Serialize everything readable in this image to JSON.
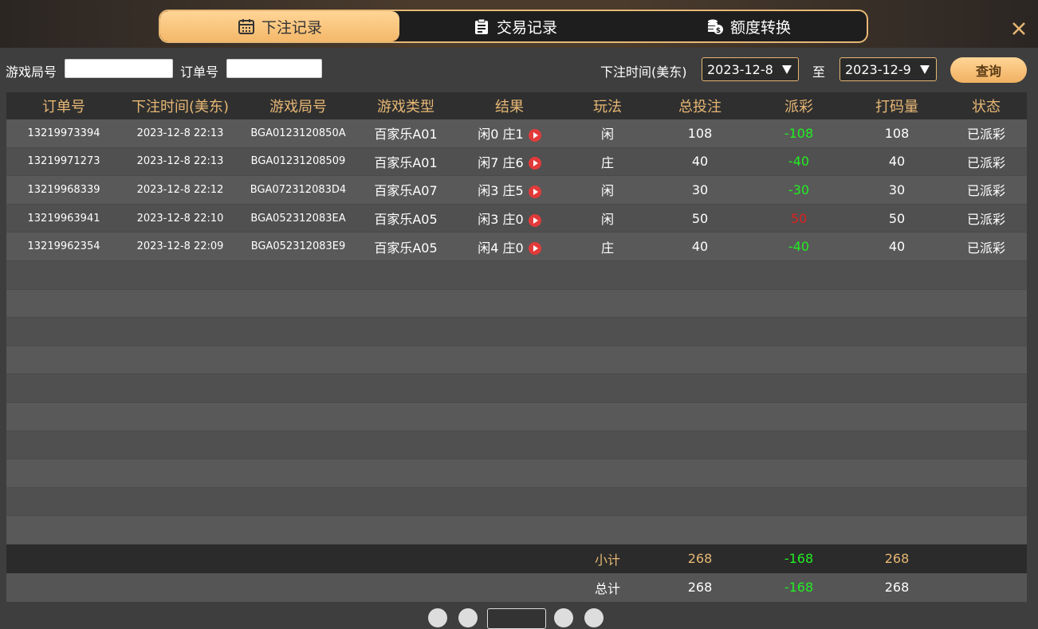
{
  "tabs": [
    {
      "label": "下注记录",
      "icon": "calendar-icon",
      "active": true
    },
    {
      "label": "交易记录",
      "icon": "clipboard-icon",
      "active": false
    },
    {
      "label": "额度转换",
      "icon": "coins-icon",
      "active": false
    }
  ],
  "filter": {
    "round_label": "游戏局号",
    "order_label": "订单号",
    "round_value": "",
    "order_value": "",
    "time_label": "下注时间(美东)",
    "date_from": "2023-12-8",
    "to_label": "至",
    "date_to": "2023-12-9",
    "query_label": "查询"
  },
  "table": {
    "headers": [
      "订单号",
      "下注时间(美东)",
      "游戏局号",
      "游戏类型",
      "结果",
      "玩法",
      "总投注",
      "派彩",
      "打码量",
      "状态"
    ],
    "rows": [
      {
        "order": "13219973394",
        "time": "2023-12-8 22:13",
        "round": "BGA0123120850A",
        "game": "百家乐A01",
        "result": "闲0 庄1",
        "play": "闲",
        "bet": "108",
        "payout": "-108",
        "rolling": "108",
        "status": "已派彩"
      },
      {
        "order": "13219971273",
        "time": "2023-12-8 22:13",
        "round": "BGA01231208509",
        "game": "百家乐A01",
        "result": "闲7 庄6",
        "play": "庄",
        "bet": "40",
        "payout": "-40",
        "rolling": "40",
        "status": "已派彩"
      },
      {
        "order": "13219968339",
        "time": "2023-12-8 22:12",
        "round": "BGA072312083D4",
        "game": "百家乐A07",
        "result": "闲3 庄5",
        "play": "闲",
        "bet": "30",
        "payout": "-30",
        "rolling": "30",
        "status": "已派彩"
      },
      {
        "order": "13219963941",
        "time": "2023-12-8 22:10",
        "round": "BGA052312083EA",
        "game": "百家乐A05",
        "result": "闲3 庄0",
        "play": "闲",
        "bet": "50",
        "payout": "50",
        "rolling": "50",
        "status": "已派彩"
      },
      {
        "order": "13219962354",
        "time": "2023-12-8 22:09",
        "round": "BGA052312083E9",
        "game": "百家乐A05",
        "result": "闲4 庄0",
        "play": "庄",
        "bet": "40",
        "payout": "-40",
        "rolling": "40",
        "status": "已派彩"
      }
    ],
    "subtotal": {
      "label": "小计",
      "bet": "268",
      "payout": "-168",
      "rolling": "268"
    },
    "total": {
      "label": "总计",
      "bet": "268",
      "payout": "-168",
      "rolling": "268"
    }
  },
  "colors": {
    "accent": "#e7b774",
    "negative": "#22ee22",
    "positive": "#e02020"
  }
}
